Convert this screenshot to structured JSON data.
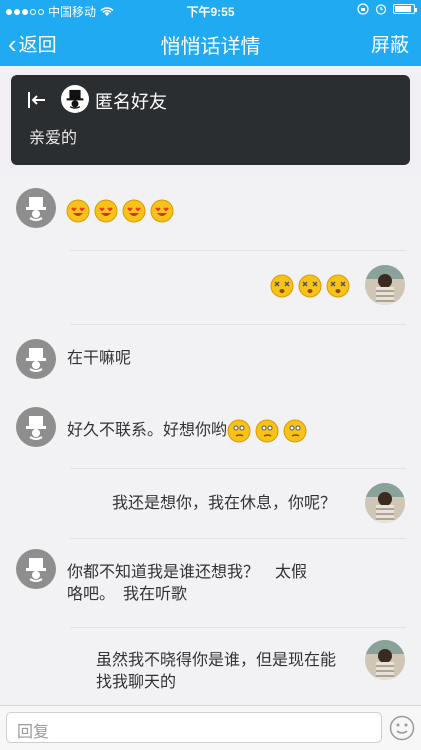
{
  "status": {
    "carrier": "中国移动",
    "time": "下午9:55"
  },
  "nav": {
    "back_label": "返回",
    "title": "悄悄话详情",
    "block_label": "屏蔽"
  },
  "origin": {
    "name": "匿名好友",
    "text": "亲爱的"
  },
  "messages": [
    {
      "side": "left",
      "text": "",
      "emoji": "smile-heart",
      "emoji_count": 4
    },
    {
      "side": "right",
      "text": "",
      "emoji": "dizzy",
      "emoji_count": 3
    },
    {
      "side": "left",
      "text": "在干嘛呢"
    },
    {
      "side": "left",
      "text": "好久不联系。好想你哟",
      "emoji": "thinking",
      "emoji_count": 3
    },
    {
      "side": "right",
      "text": "我还是想你，我在休息，你呢？"
    },
    {
      "side": "left",
      "line1": "你都不知道我是谁还想我？　太假",
      "line2": "咯吧。　我在听歌"
    },
    {
      "side": "right",
      "line1": "虽然我不晓得你是谁，但是现在能",
      "line2": "找我聊天的"
    }
  ],
  "input": {
    "placeholder": "回复"
  },
  "colors": {
    "accent": "#1faaf1",
    "dark_card": "#2b2e30"
  }
}
